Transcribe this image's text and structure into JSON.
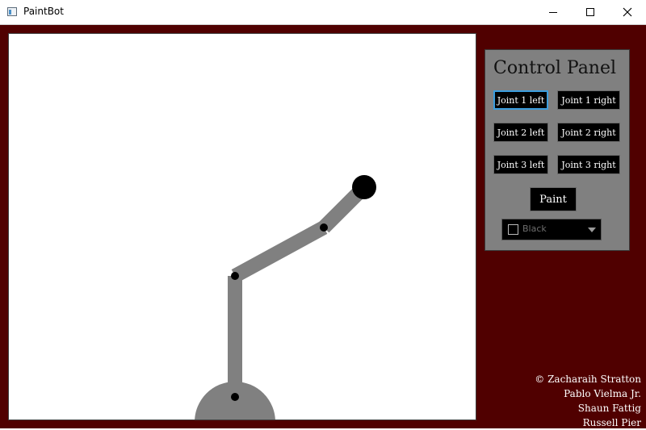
{
  "window": {
    "title": "PaintBot",
    "icon": "app-window-icon",
    "controls": [
      "minimize-icon",
      "maximize-icon",
      "close-icon"
    ]
  },
  "colors": {
    "background": "#500000",
    "canvas": "#ffffff",
    "arm": "#808080",
    "joint": "#000000",
    "panel": "#808080",
    "button": "#000000",
    "focus": "#3b9ddd"
  },
  "control_panel": {
    "title": "Control Panel",
    "buttons": [
      {
        "label": "Joint 1 left"
      },
      {
        "label": "Joint 1 right"
      },
      {
        "label": "Joint 2 left"
      },
      {
        "label": "Joint 2 right"
      },
      {
        "label": "Joint 3 left"
      },
      {
        "label": "Joint 3 right"
      }
    ],
    "focused_button": "Joint 1 left",
    "paint_label": "Paint",
    "color_select": {
      "value": "Black",
      "swatch": "#000000"
    }
  },
  "credits": [
    "© Zacharaih Stratton",
    "Pablo Vielma Jr.",
    "Shaun Fattig",
    "Russell Pier"
  ]
}
